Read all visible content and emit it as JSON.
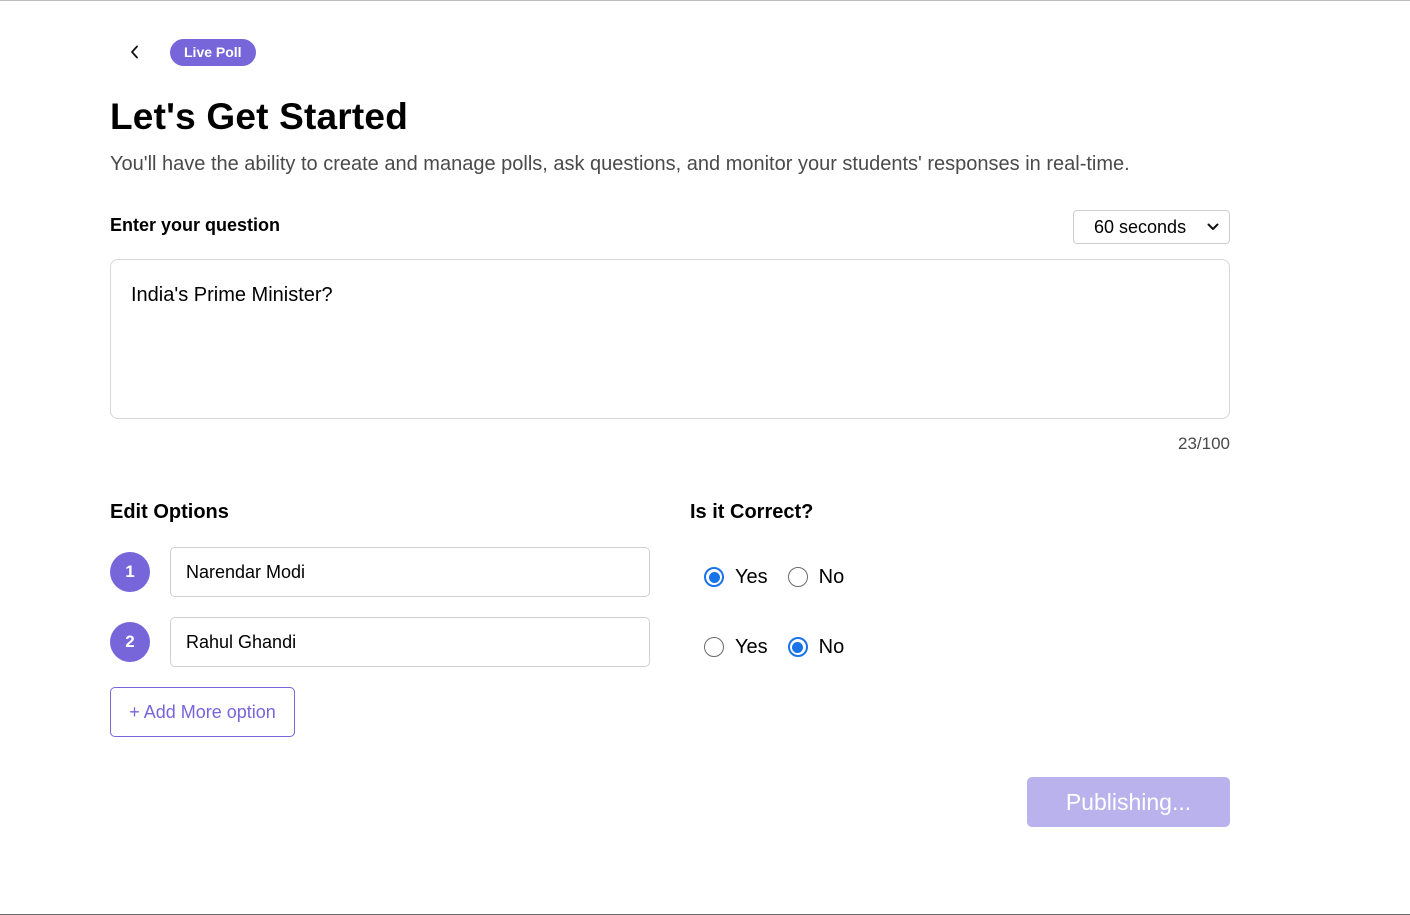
{
  "header": {
    "back_icon": "chevron-left-icon",
    "badge": "Live Poll"
  },
  "intro": {
    "title": "Let's Get Started",
    "subtitle": "You'll have the ability to create and manage polls, ask questions, and monitor your students' responses in real-time."
  },
  "question": {
    "label": "Enter your question",
    "timer_value": "60 seconds",
    "text": "India's Prime Minister?",
    "counter": "23/100"
  },
  "options": {
    "heading": "Edit Options",
    "correct_heading": "Is it Correct?",
    "items": [
      {
        "number": "1",
        "value": "Narendar Modi",
        "correct": "Yes"
      },
      {
        "number": "2",
        "value": "Rahul Ghandi",
        "correct": "No"
      }
    ],
    "yes_label": "Yes",
    "no_label": "No",
    "add_label": "+ Add More option"
  },
  "actions": {
    "publish_label": "Publishing..."
  },
  "colors": {
    "accent": "#7765da",
    "radio_checked": "#1a73e8",
    "publish_disabled": "#b9b2ec"
  }
}
